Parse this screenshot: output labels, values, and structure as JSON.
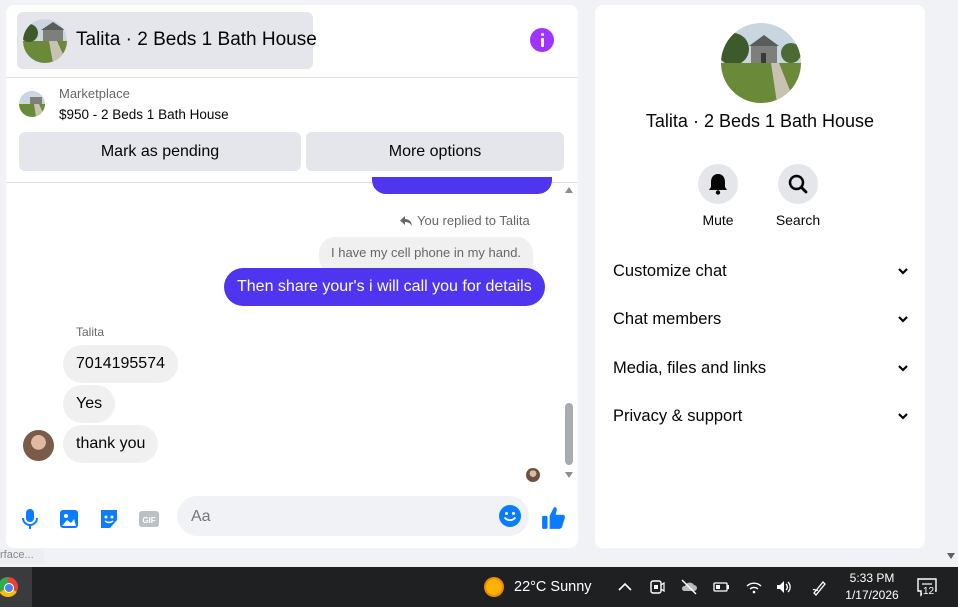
{
  "chat": {
    "title": "Talita · 2 Beds 1 Bath House",
    "marketplace": {
      "label": "Marketplace",
      "listing": "$950 - 2 Beds 1 Bath House",
      "mark_pending": "Mark as pending",
      "more_options": "More options"
    },
    "messages": {
      "reply_note": "You replied to Talita",
      "quoted": "I have my cell phone in my hand.",
      "outgoing": "Then share your's i will call you for details",
      "sender": "Talita",
      "incoming": [
        "7014195574",
        "Yes",
        "thank you"
      ]
    },
    "composer": {
      "placeholder": "Aa"
    },
    "colors": {
      "outgoing_bubble": "#4f35f0",
      "accent_icons": "#0a7cff",
      "info_button": "#a033ff"
    }
  },
  "info_panel": {
    "title": "Talita · 2 Beds 1 Bath House",
    "actions": [
      {
        "label": "Mute",
        "icon": "bell-icon"
      },
      {
        "label": "Search",
        "icon": "search-icon"
      }
    ],
    "sections": [
      "Customize chat",
      "Chat members",
      "Media, files and links",
      "Privacy & support"
    ]
  },
  "status_hint": "rface...",
  "taskbar": {
    "weather": "22°C  Sunny",
    "time": "5:33 PM",
    "date": "1/17/2026",
    "notifications": "12"
  }
}
